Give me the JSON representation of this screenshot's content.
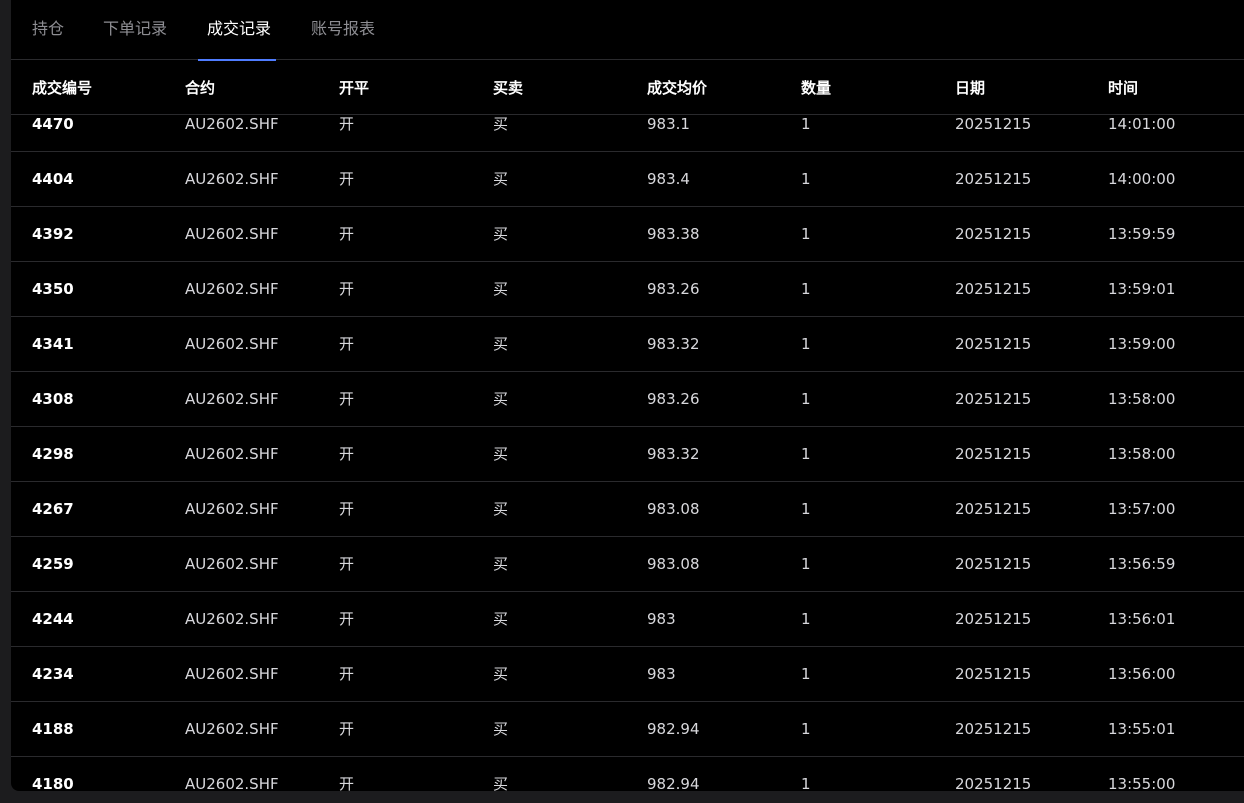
{
  "tabs": [
    {
      "label": "持仓",
      "active": false
    },
    {
      "label": "下单记录",
      "active": false
    },
    {
      "label": "成交记录",
      "active": true
    },
    {
      "label": "账号报表",
      "active": false
    }
  ],
  "colors": {
    "accent": "#4f7cff",
    "background": "#000000",
    "divider": "#2a2a2d"
  },
  "table": {
    "columns": [
      "成交编号",
      "合约",
      "开平",
      "买卖",
      "成交均价",
      "数量",
      "日期",
      "时间"
    ],
    "rows": [
      [
        "4470",
        "AU2602.SHF",
        "开",
        "买",
        "983.1",
        "1",
        "20251215",
        "14:01:00"
      ],
      [
        "4404",
        "AU2602.SHF",
        "开",
        "买",
        "983.4",
        "1",
        "20251215",
        "14:00:00"
      ],
      [
        "4392",
        "AU2602.SHF",
        "开",
        "买",
        "983.38",
        "1",
        "20251215",
        "13:59:59"
      ],
      [
        "4350",
        "AU2602.SHF",
        "开",
        "买",
        "983.26",
        "1",
        "20251215",
        "13:59:01"
      ],
      [
        "4341",
        "AU2602.SHF",
        "开",
        "买",
        "983.32",
        "1",
        "20251215",
        "13:59:00"
      ],
      [
        "4308",
        "AU2602.SHF",
        "开",
        "买",
        "983.26",
        "1",
        "20251215",
        "13:58:00"
      ],
      [
        "4298",
        "AU2602.SHF",
        "开",
        "买",
        "983.32",
        "1",
        "20251215",
        "13:58:00"
      ],
      [
        "4267",
        "AU2602.SHF",
        "开",
        "买",
        "983.08",
        "1",
        "20251215",
        "13:57:00"
      ],
      [
        "4259",
        "AU2602.SHF",
        "开",
        "买",
        "983.08",
        "1",
        "20251215",
        "13:56:59"
      ],
      [
        "4244",
        "AU2602.SHF",
        "开",
        "买",
        "983",
        "1",
        "20251215",
        "13:56:01"
      ],
      [
        "4234",
        "AU2602.SHF",
        "开",
        "买",
        "983",
        "1",
        "20251215",
        "13:56:00"
      ],
      [
        "4188",
        "AU2602.SHF",
        "开",
        "买",
        "982.94",
        "1",
        "20251215",
        "13:55:01"
      ],
      [
        "4180",
        "AU2602.SHF",
        "开",
        "买",
        "982.94",
        "1",
        "20251215",
        "13:55:00"
      ]
    ]
  }
}
